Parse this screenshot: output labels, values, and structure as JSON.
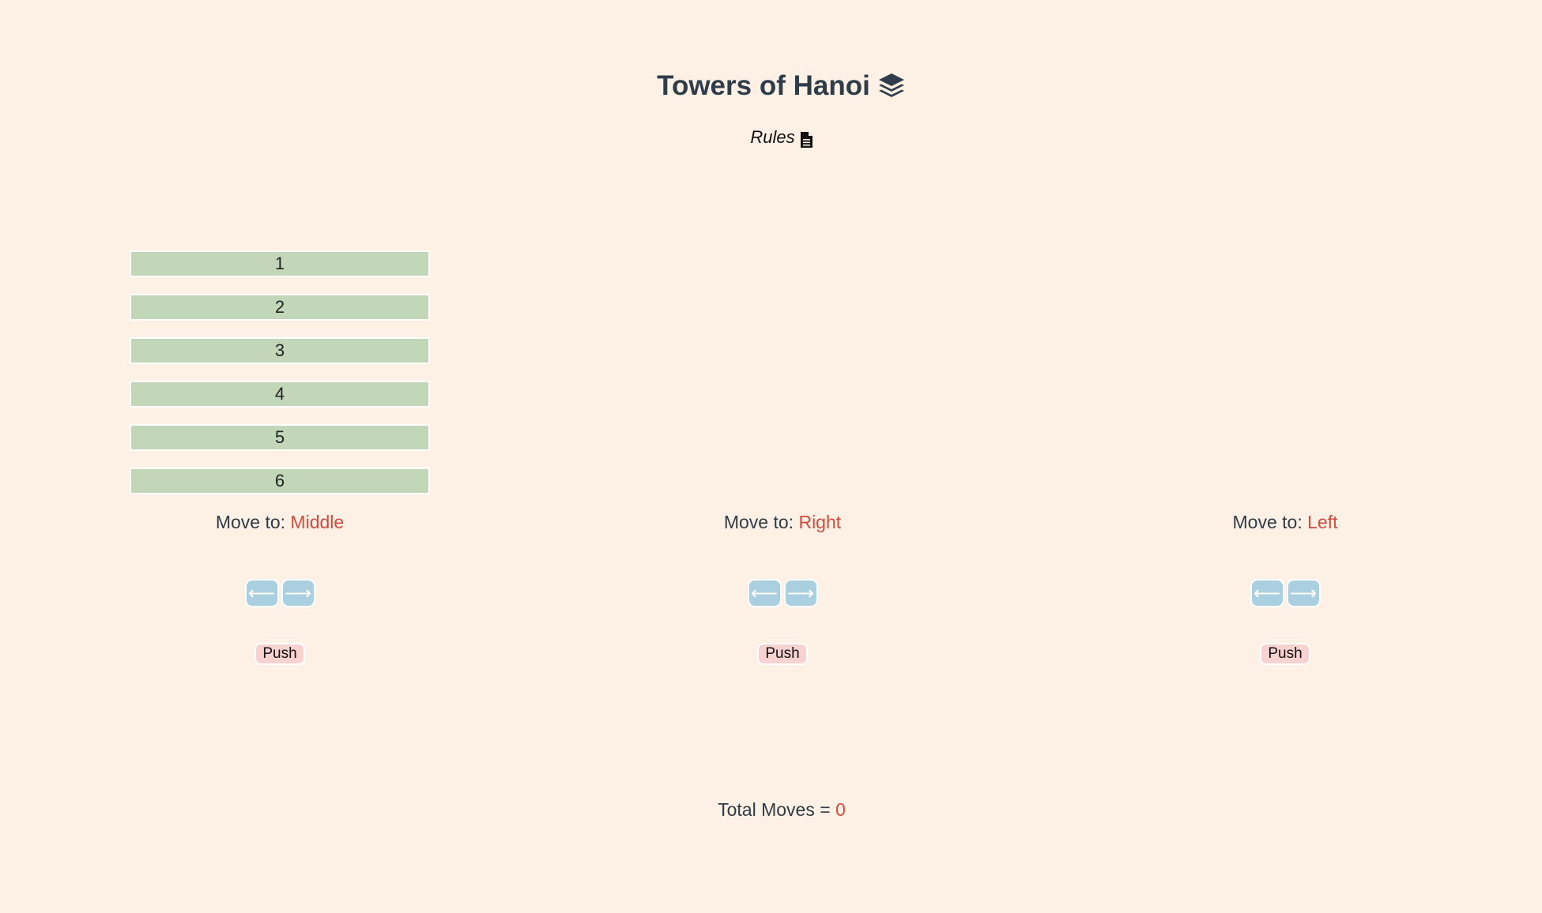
{
  "header": {
    "title": "Towers of Hanoi",
    "title_icon": "layer-stack-icon",
    "rules_label": "Rules",
    "rules_icon": "document-icon"
  },
  "towers": [
    {
      "disks": [
        "1",
        "2",
        "3",
        "4",
        "5",
        "6"
      ],
      "move_label": "Move to: ",
      "move_target": "Middle",
      "left_arrow": "⟵",
      "right_arrow": "⟶",
      "push_label": "Push"
    },
    {
      "disks": [],
      "move_label": "Move to: ",
      "move_target": "Right",
      "left_arrow": "⟵",
      "right_arrow": "⟶",
      "push_label": "Push"
    },
    {
      "disks": [],
      "move_label": "Move to: ",
      "move_target": "Left",
      "left_arrow": "⟵",
      "right_arrow": "⟶",
      "push_label": "Push"
    }
  ],
  "footer": {
    "total_label": "Total Moves = ",
    "total_moves": "0"
  },
  "colors": {
    "background": "#fdf1e6",
    "disk": "#c2d7b8",
    "accent": "#d24b3e",
    "arrow_button": "#aacfde",
    "push_button": "#f8d2d0"
  }
}
